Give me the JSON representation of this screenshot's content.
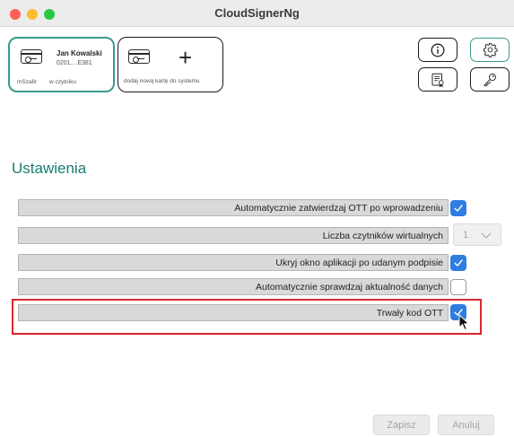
{
  "window": {
    "title": "CloudSignerNg"
  },
  "cards": [
    {
      "name": "Jan Kowalski",
      "number": "0201....E381",
      "sub_left": "mSzafir",
      "sub_right": "w czytniku"
    },
    {
      "add_label": "dodaj nową kartę do systemu",
      "plus": "+"
    }
  ],
  "toolbar": {
    "info_icon": "info-icon",
    "settings_icon": "gear-icon",
    "certificate_icon": "certificate-icon",
    "key_icon": "key-icon"
  },
  "settings": {
    "heading": "Ustawienia",
    "rows": [
      {
        "label": "Automatycznie zatwierdzaj OTT po wprowadzeniu",
        "checked": true
      },
      {
        "label": "Liczba czytników wirtualnych",
        "select_value": "1"
      },
      {
        "label": "Ukryj okno aplikacji po udanym podpisie",
        "checked": true
      },
      {
        "label": "Automatycznie sprawdzaj aktualność danych",
        "checked": false
      },
      {
        "label": "Trwały kod OTT",
        "checked": true
      }
    ]
  },
  "footer": {
    "save": "Zapisz",
    "cancel": "Anuluj"
  },
  "colors": {
    "accent": "#1a7d6d",
    "checkbox": "#2f7de1",
    "highlight": "#d7262e"
  }
}
